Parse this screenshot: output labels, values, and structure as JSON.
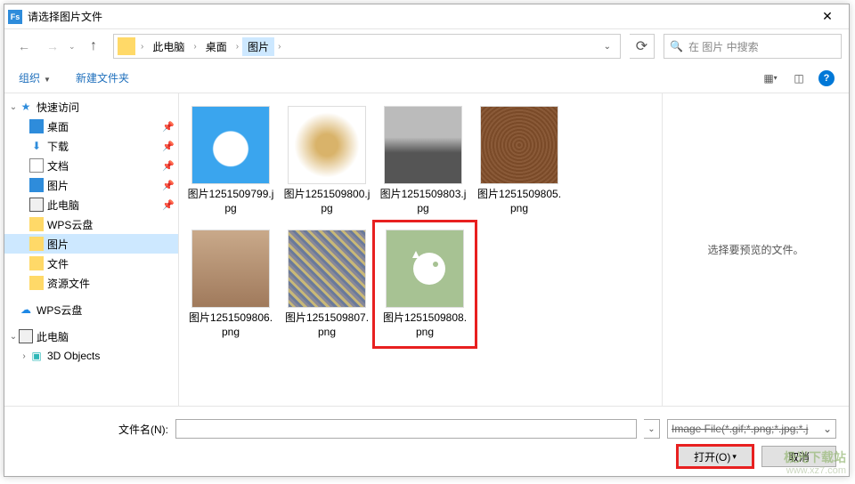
{
  "titlebar": {
    "text": "请选择图片文件"
  },
  "breadcrumb": {
    "pc": "此电脑",
    "desktop": "桌面",
    "current": "图片"
  },
  "search": {
    "placeholder": "在 图片 中搜索"
  },
  "toolbar": {
    "organize": "组织",
    "new_folder": "新建文件夹"
  },
  "sidebar": {
    "quick_access": "快速访问",
    "desktop": "桌面",
    "downloads": "下载",
    "documents": "文档",
    "pictures": "图片",
    "this_pc_q": "此电脑",
    "wps_cloud_q": "WPS云盘",
    "images_sel": "图片",
    "files": "文件",
    "resources": "资源文件",
    "wps_cloud": "WPS云盘",
    "this_pc": "此电脑",
    "three_d": "3D Objects"
  },
  "files": {
    "label_prefix": "图片",
    "f1": "图片1251509799.jpg",
    "f2": "图片1251509800.jpg",
    "f3": "图片1251509803.jpg",
    "f4": "图片1251509805.png",
    "f5": "图片1251509806.png",
    "f6": "图片1251509807.png",
    "f7": "图片1251509808.png"
  },
  "preview": {
    "empty_text": "选择要预览的文件。"
  },
  "bottom": {
    "filename_label": "文件名(N):",
    "filter": "Image File(*.gif;*.png;*.jpg;*.j",
    "open": "打开(O)",
    "cancel": "取消"
  },
  "watermark": {
    "line1": "极光下载站",
    "line2": "www.xz7.com"
  }
}
